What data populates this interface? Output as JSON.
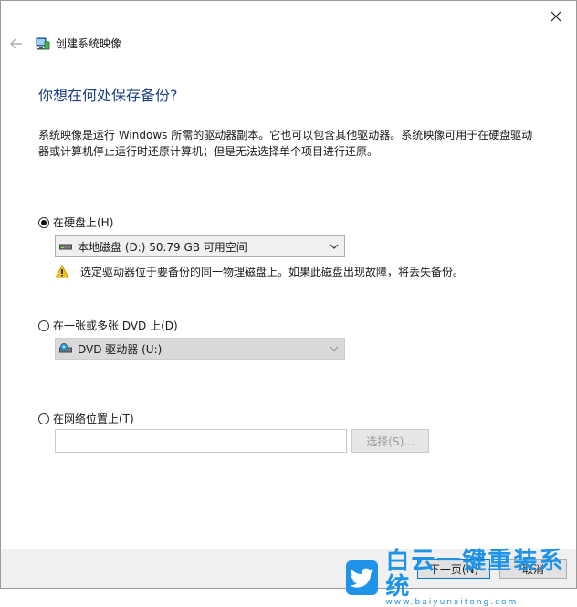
{
  "window": {
    "title": "创建系统映像"
  },
  "heading": "你想在何处保存备份?",
  "description": "系统映像是运行 Windows 所需的驱动器副本。它也可以包含其他驱动器。系统映像可用于在硬盘驱动器或计算机停止运行时还原计算机；但是无法选择单个项目进行还原。",
  "options": {
    "hard_disk": {
      "label": "在硬盘上(H)",
      "selected": true,
      "combo_value": "本地磁盘 (D:)  50.79 GB 可用空间",
      "combo_icon": "drive-icon",
      "warning": "选定驱动器位于要备份的同一物理磁盘上。如果此磁盘出现故障，将丢失备份。",
      "warning_icon": "warning-icon"
    },
    "dvd": {
      "label": "在一张或多张 DVD 上(D)",
      "selected": false,
      "combo_value": "DVD 驱动器 (U:)",
      "combo_icon": "dvd-drive-icon"
    },
    "network": {
      "label": "在网络位置上(T)",
      "selected": false,
      "input_value": "",
      "select_button": "选择(S)..."
    }
  },
  "footer": {
    "next_button": "下一页(N)",
    "cancel_button": "取消"
  },
  "watermark": {
    "text": "白云一键重装系统",
    "url": "www.baiyunxitong.com"
  },
  "colors": {
    "heading": "#1e3f8a",
    "primary_border": "#0078d7",
    "footer_bg": "#f0f0f0",
    "warning": "#f5c518",
    "watermark": "#1f93e8"
  }
}
